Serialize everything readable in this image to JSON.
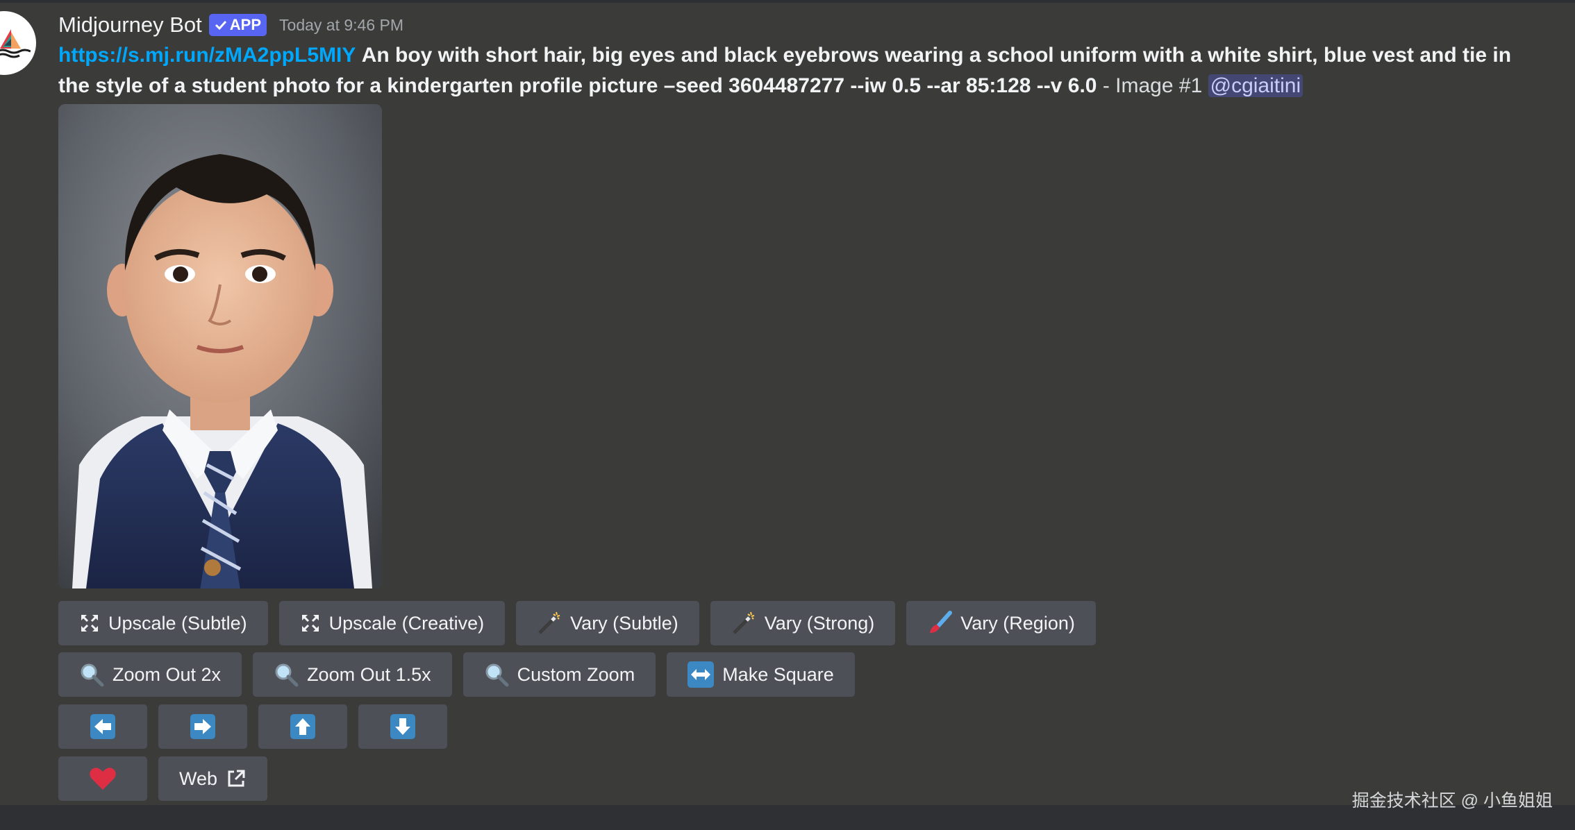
{
  "message": {
    "author": "Midjourney Bot",
    "badge": "APP",
    "timestamp": "Today at 9:46 PM",
    "link": "https://s.mj.run/zMA2ppL5MIY",
    "prompt": "An boy with short hair, big eyes and black eyebrows wearing a school uniform with a white shirt, blue vest and tie in the style of a student photo for a kindergarten profile picture –seed 3604487277 --iw 0.5 --ar 85:128 --v 6.0",
    "image_label": "- Image #1",
    "mention": "@cgiaitini"
  },
  "buttons": {
    "row1": [
      {
        "label": "Upscale (Subtle)",
        "icon": "expand-arrows-icon"
      },
      {
        "label": "Upscale (Creative)",
        "icon": "expand-arrows-icon"
      },
      {
        "label": "Vary (Subtle)",
        "icon": "magic-wand-icon"
      },
      {
        "label": "Vary (Strong)",
        "icon": "magic-wand-icon"
      },
      {
        "label": "Vary (Region)",
        "icon": "paintbrush-icon"
      }
    ],
    "row2": [
      {
        "label": "Zoom Out 2x",
        "icon": "magnifier-icon"
      },
      {
        "label": "Zoom Out 1.5x",
        "icon": "magnifier-icon"
      },
      {
        "label": "Custom Zoom",
        "icon": "magnifier-icon"
      },
      {
        "label": "Make Square",
        "icon": "left-right-arrow-icon"
      }
    ],
    "row3": [
      "arrow-left-icon",
      "arrow-right-icon",
      "arrow-up-icon",
      "arrow-down-icon"
    ],
    "row4": {
      "favorite_icon": "heart-icon",
      "web_label": "Web",
      "web_icon": "external-link-icon"
    }
  },
  "watermark": "掘金技术社区 @ 小鱼姐姐",
  "colors": {
    "background": "#3b3b3a",
    "button": "#4e5058",
    "badge": "#5865f2",
    "link": "#00a8fc",
    "mention_bg": "#5865f24d",
    "heart": "#dd2e44",
    "arrow_tile": "#3b88c3"
  }
}
